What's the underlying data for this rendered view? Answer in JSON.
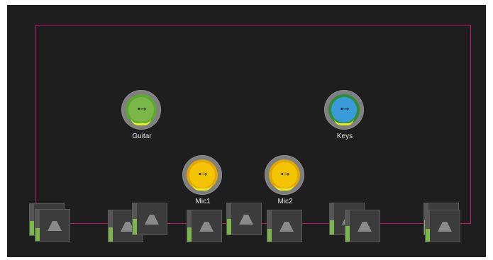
{
  "colors": {
    "background": "#1e1e1e",
    "room_border": "#c0186f",
    "meter_green": "#7ab648",
    "trim_yellow": "#e8ef1a"
  },
  "sources": [
    {
      "id": "guitar",
      "label": "Guitar",
      "color": "#7ab648",
      "ring": "#5ea832",
      "icon": "arrow-right-icon"
    },
    {
      "id": "keys",
      "label": "Keys",
      "color": "#3a9bd9",
      "ring": "#2e8c3a",
      "icon": "arrow-right-icon"
    },
    {
      "id": "mic1",
      "label": "Mic1",
      "color": "#f5c400",
      "ring": "#e0a800",
      "icon": "arrow-right-icon"
    },
    {
      "id": "mic2",
      "label": "Mic2",
      "color": "#f5c400",
      "ring": "#e0a800",
      "icon": "arrow-right-icon"
    }
  ],
  "speakers": [
    {
      "id": "spk1",
      "level": 0.45
    },
    {
      "id": "spk2",
      "level": 0.4
    },
    {
      "id": "spk3",
      "level": 0.45
    },
    {
      "id": "spk4",
      "level": 0.5
    },
    {
      "id": "spk5",
      "level": 0.45
    },
    {
      "id": "spk6",
      "level": 0.5
    },
    {
      "id": "spk7",
      "level": 0.4
    },
    {
      "id": "spk8",
      "level": 0.45
    },
    {
      "id": "spk9",
      "level": 0.5
    },
    {
      "id": "spk10",
      "level": 0.45
    },
    {
      "id": "spk11",
      "level": 0.4
    },
    {
      "id": "spk12",
      "level": 0.45
    }
  ]
}
